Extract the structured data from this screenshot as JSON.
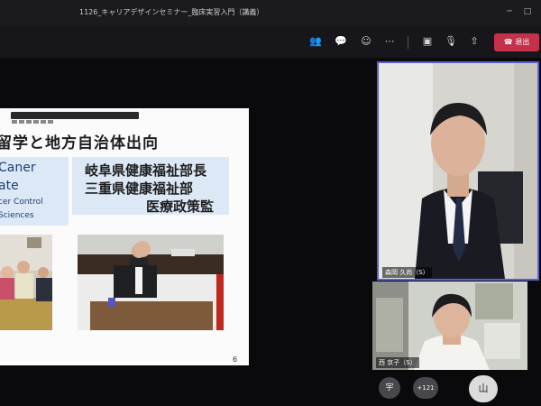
{
  "window": {
    "title": "1126_キャリアデザインセミナー_臨床実習入門（講義）",
    "minimize_icon": "minimize-icon",
    "maximize_icon": "maximize-icon"
  },
  "toolbar": {
    "leave_label": "退出",
    "icons": [
      "people-icon",
      "chat-icon",
      "reactions-icon",
      "more-icon",
      "camera-off-icon",
      "mic-off-icon",
      "share-icon",
      "phone-icon"
    ],
    "accent": "#c4314b"
  },
  "slide": {
    "title": "留学と地方自治体出向",
    "left_box": [
      "Caner",
      "ate",
      "cer Control",
      "Sciences"
    ],
    "right_box": [
      "岐阜県健康福祉部長",
      "三重県健康福祉部",
      "医療政策監"
    ],
    "page_number": "6"
  },
  "participants": {
    "main_name": "森岡 久尚（S）",
    "second_name": "西 京子（S）",
    "bottom_avatar_1": "宇",
    "bottom_count": "+121",
    "bottom_avatar_2": "山"
  }
}
